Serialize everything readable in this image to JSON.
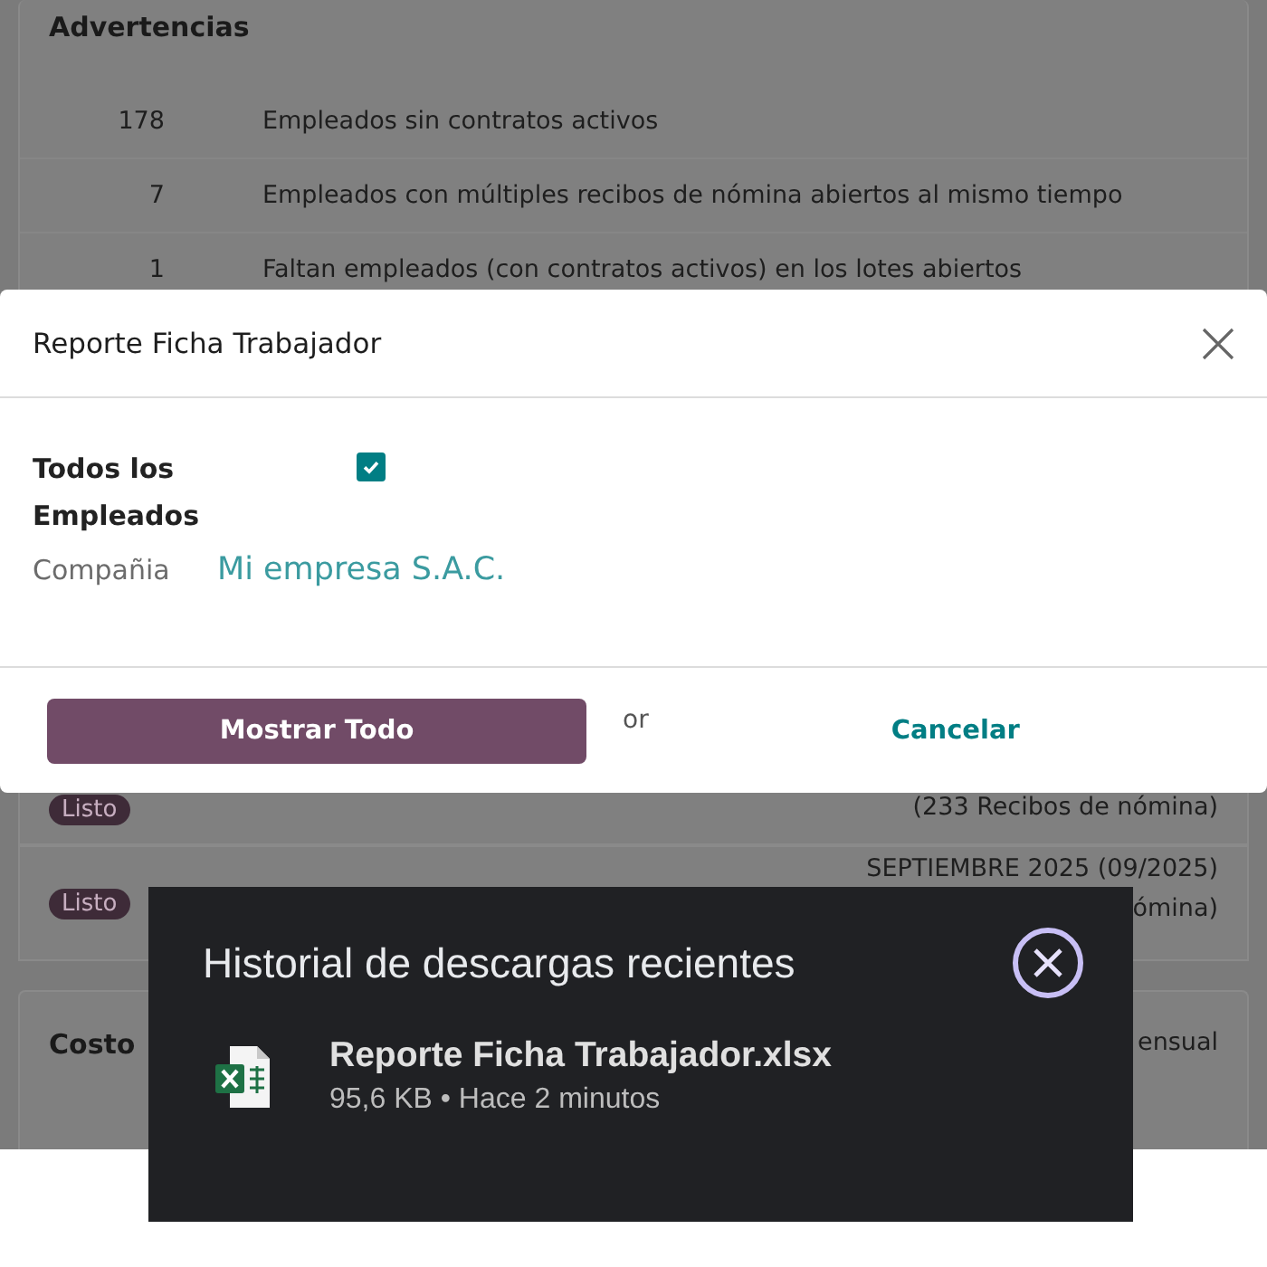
{
  "warnings": {
    "title": "Advertencias",
    "rows": [
      {
        "count": "178",
        "text": "Empleados sin contratos activos"
      },
      {
        "count": "7",
        "text": "Empleados con múltiples recibos de nómina abiertos al mismo tiempo"
      },
      {
        "count": "1",
        "text": "Faltan empleados (con contratos activos) en los lotes abiertos"
      }
    ]
  },
  "batches": [
    {
      "status": "Listo",
      "lines": [
        "(233 Recibos de nómina)"
      ]
    },
    {
      "status": "Listo",
      "lines": [
        "SEPTIEMBRE 2025 (09/2025)",
        "ómina)"
      ]
    }
  ],
  "cost_card": {
    "title": "Costo",
    "column_2": "ensual"
  },
  "dialog": {
    "title": "Reporte Ficha Trabajador",
    "fields": [
      {
        "kind": "checkbox",
        "label": "Todos los Empleados",
        "checked": true
      },
      {
        "kind": "link",
        "label": "Compañia",
        "value": "Mi empresa S.A.C."
      }
    ],
    "primary_button": "Mostrar Todo",
    "separator": "or",
    "cancel_button": "Cancelar"
  },
  "downloads": {
    "title": "Historial de descargas recientes",
    "items": [
      {
        "name": "Reporte Ficha Trabajador.xlsx",
        "details": "95,6 KB • Hace 2 minutos"
      }
    ]
  }
}
